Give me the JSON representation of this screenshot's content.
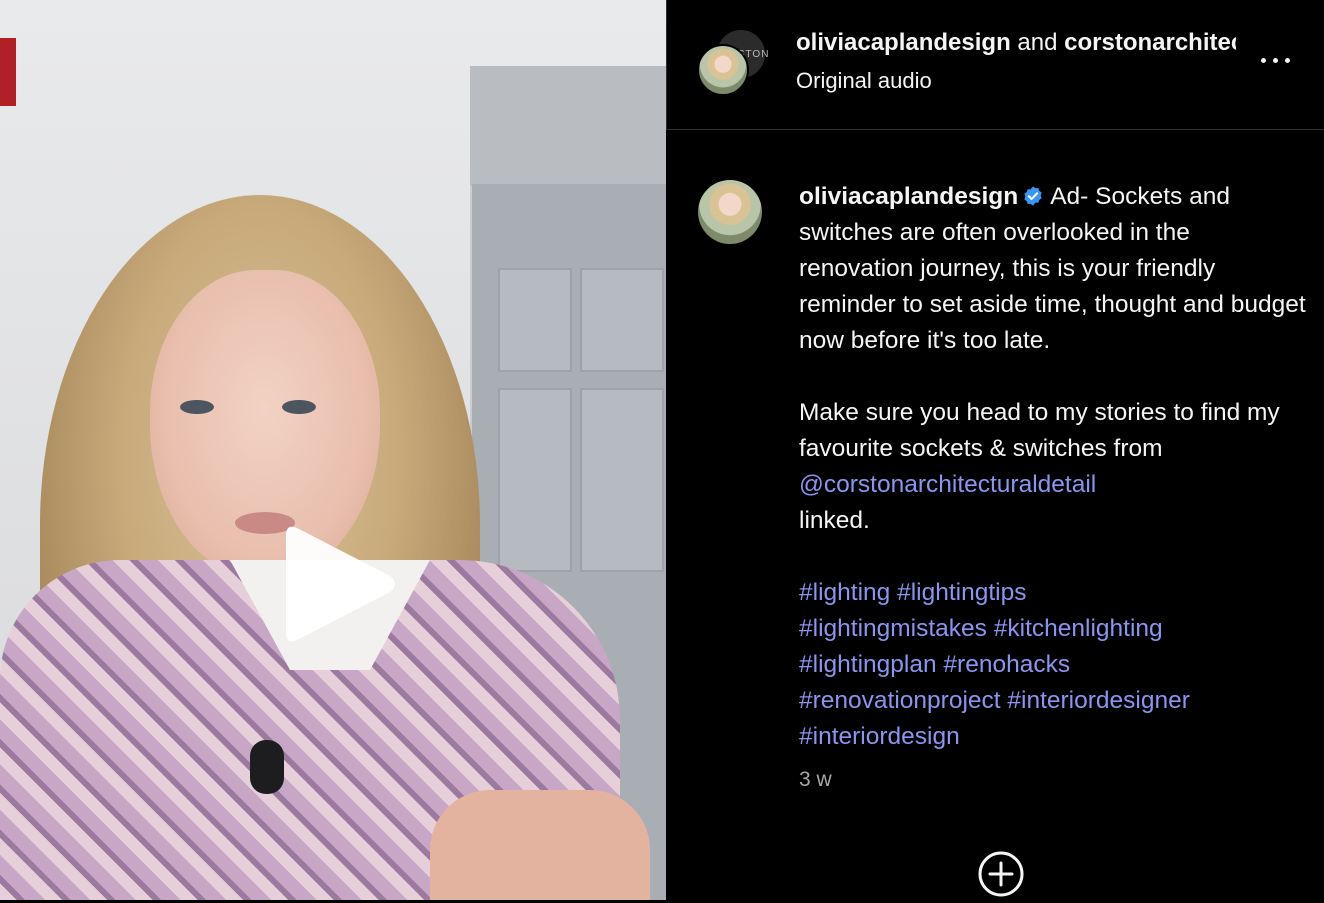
{
  "header": {
    "user1": "oliviacaplandesign",
    "joiner": " and ",
    "user2": "corstonarchitecturaldetail",
    "subtitle": "Original audio",
    "collab_avatar_text": "CORSTON"
  },
  "caption": {
    "username": "oliviacaplandesign",
    "text1": "Ad- Sockets and switches are often overlooked in the renovation journey, this is your friendly reminder to set aside time, thought and budget now before it's too late.",
    "text2a": "Make sure you head to my stories to find my favourite sockets & switches from ",
    "mention": "@corstonarchitecturaldetail",
    "text2b": " linked.",
    "hashtags": [
      "#lighting",
      "#lightingtips",
      "#lightingmistakes",
      "#kitchenlighting",
      "#lightingplan",
      "#renohacks",
      "#renovationproject",
      "#interiordesigner",
      "#interiordesign"
    ]
  },
  "timestamp": "3 w",
  "icons": {
    "play": "play-icon",
    "more": "more-horizontal-icon",
    "verified": "verified-badge-icon",
    "add": "add-circle-icon"
  },
  "colors": {
    "link": "#8a95f0",
    "verified": "#3897f0",
    "background": "#000000"
  }
}
